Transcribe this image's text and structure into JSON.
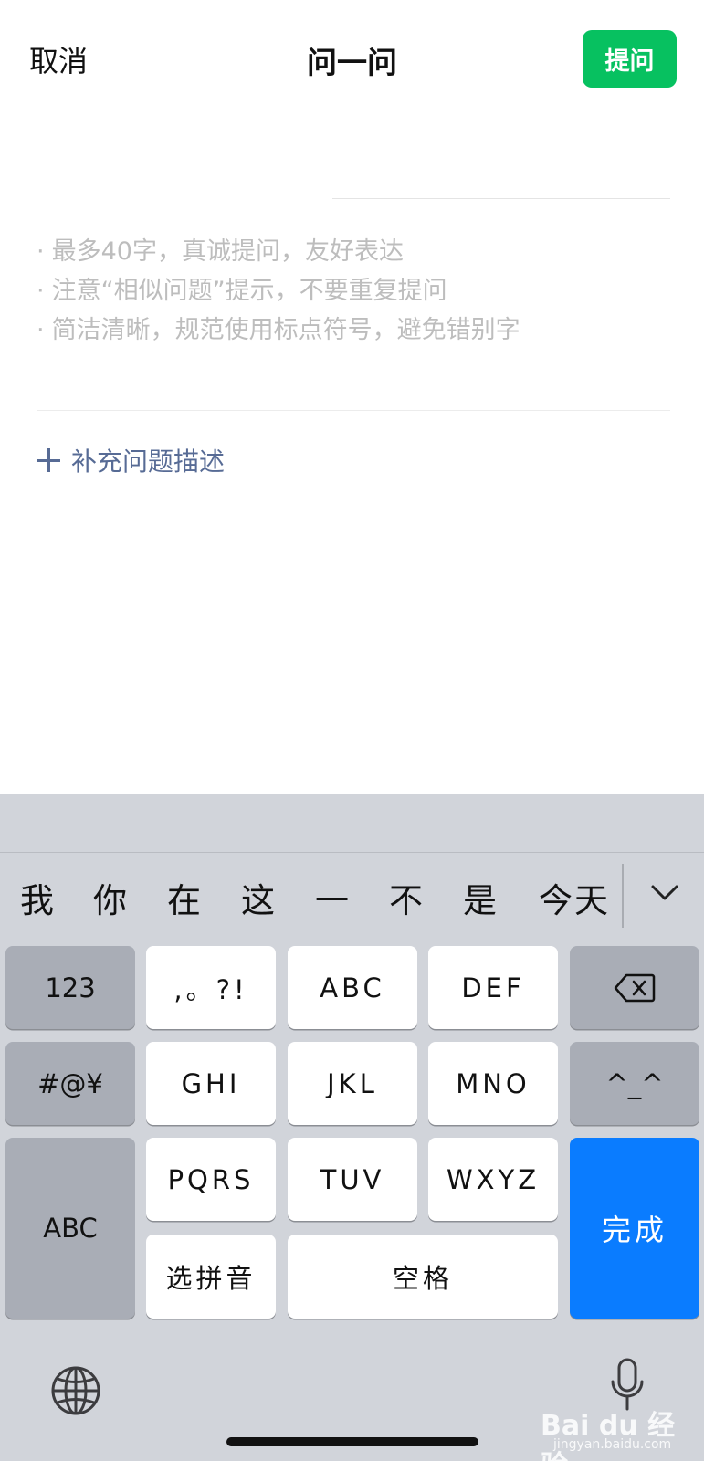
{
  "topbar": {
    "cancel_label": "取消",
    "title": "问一问",
    "ask_label": "提问"
  },
  "question": {
    "value": "",
    "hints": [
      "最多40字，真诚提问，友好表达",
      "注意“相似问题”提示，不要重复提问",
      "简洁清晰，规范使用标点符号，避免错别字"
    ],
    "hint_bullet": "·",
    "add_description_label": "补充问题描述"
  },
  "keyboard": {
    "candidates": [
      "我",
      "你",
      "在",
      "这",
      "一",
      "不",
      "是",
      "今天"
    ],
    "keys": {
      "num": "123",
      "punct": ",。?!",
      "abc_top": "ABC",
      "def": "DEF",
      "symbols": "#@¥",
      "ghi": "GHI",
      "jkl": "JKL",
      "mno": "MNO",
      "emoticon": "^_^",
      "abc_left": "ABC",
      "pqrs": "PQRS",
      "tuv": "TUV",
      "wxyz": "WXYZ",
      "done": "完成",
      "pinyin": "选拼音",
      "space": "空格"
    }
  },
  "watermark": {
    "brand": "Bai du 经验",
    "url": "jingyan.baidu.com"
  },
  "colors": {
    "accent_green": "#07c160",
    "link_blue": "#576b95",
    "key_blue": "#0a7cff"
  }
}
